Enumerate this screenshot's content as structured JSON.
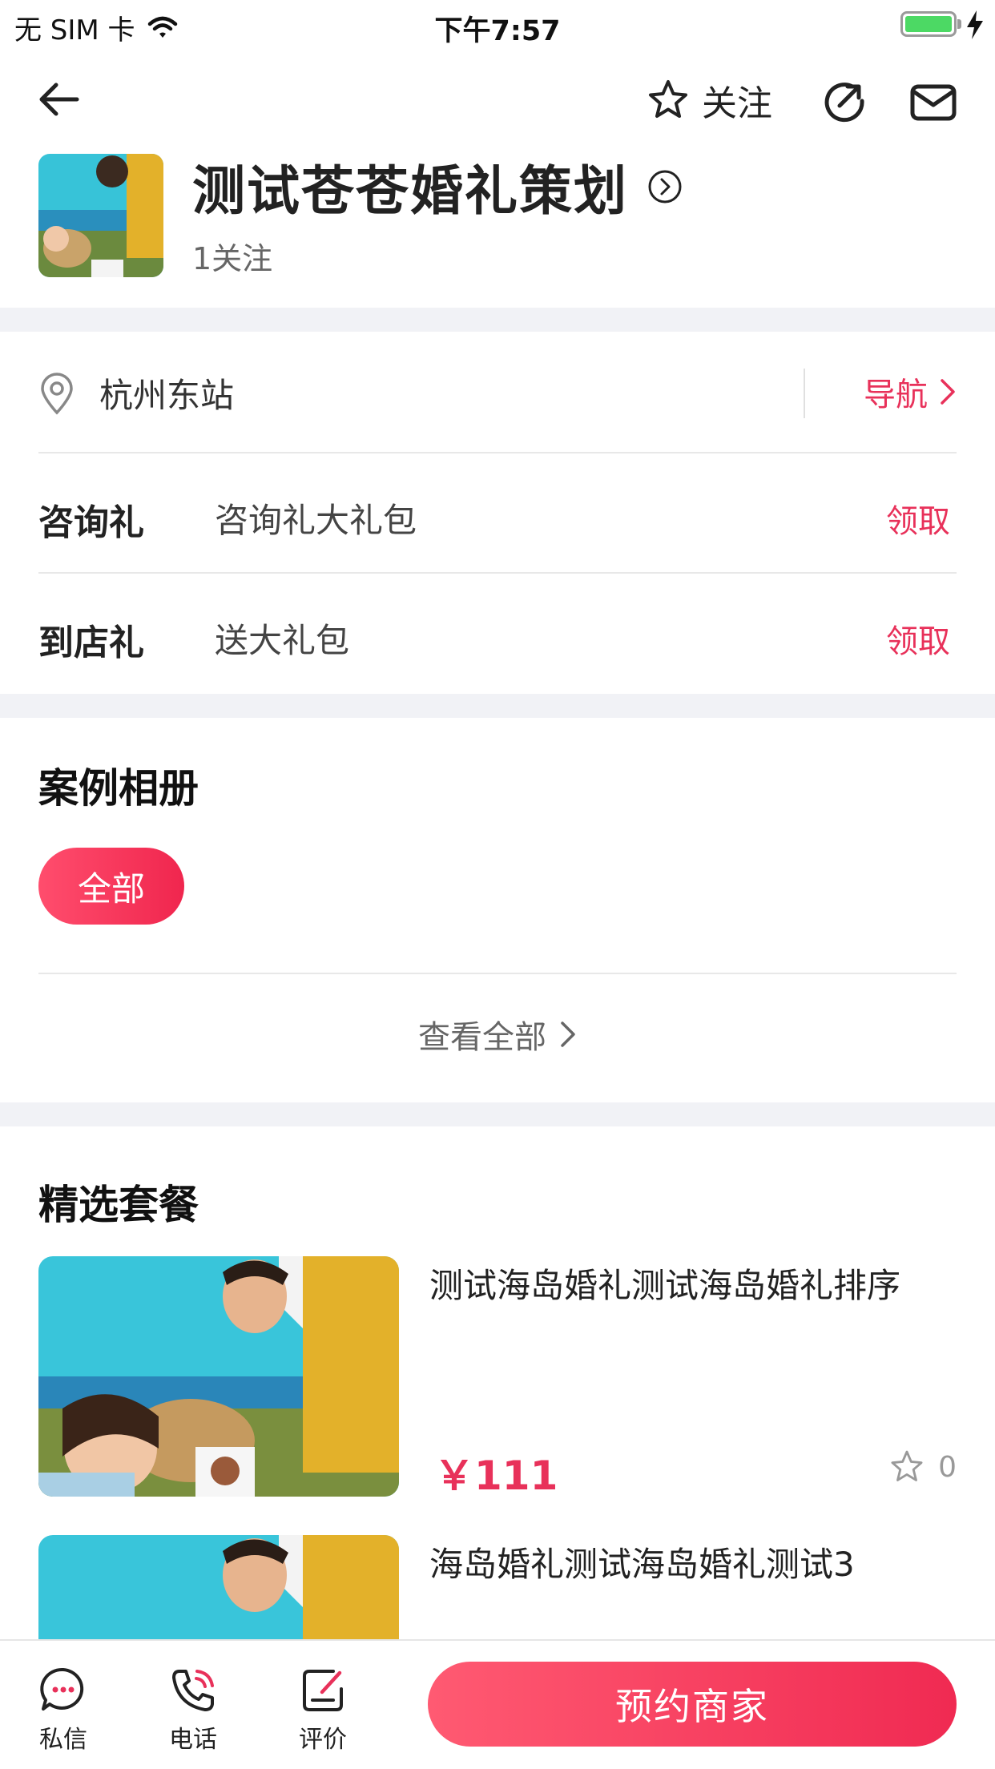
{
  "status_bar": {
    "carrier": "无 SIM 卡",
    "time": "下午7:57",
    "wifi_icon": "wifi-icon",
    "battery_color": "#4cd964"
  },
  "nav": {
    "follow_label": "关注",
    "icons": [
      "back-icon",
      "star-icon",
      "share-icon",
      "mail-icon"
    ]
  },
  "shop": {
    "name": "测试苍苍婚礼策划",
    "follows": "1关注"
  },
  "location": {
    "address": "杭州东站",
    "nav_label": "导航"
  },
  "gifts": [
    {
      "label": "咨询礼",
      "desc": "咨询礼大礼包",
      "action": "领取"
    },
    {
      "label": "到店礼",
      "desc": "送大礼包",
      "action": "领取"
    }
  ],
  "album": {
    "title": "案例相册",
    "chip": "全部",
    "view_all": "查看全部"
  },
  "packages": {
    "title": "精选套餐",
    "items": [
      {
        "title": "测试海岛婚礼测试海岛婚礼排序",
        "price": "￥111",
        "favorites": "0"
      },
      {
        "title": "海岛婚礼测试海岛婚礼测试3"
      }
    ]
  },
  "bottom_bar": {
    "message_label": "私信",
    "phone_label": "电话",
    "review_label": "评价",
    "book_label": "预约商家"
  },
  "colors": {
    "accent": "#e8315a",
    "background_gap": "#f1f2f6"
  }
}
